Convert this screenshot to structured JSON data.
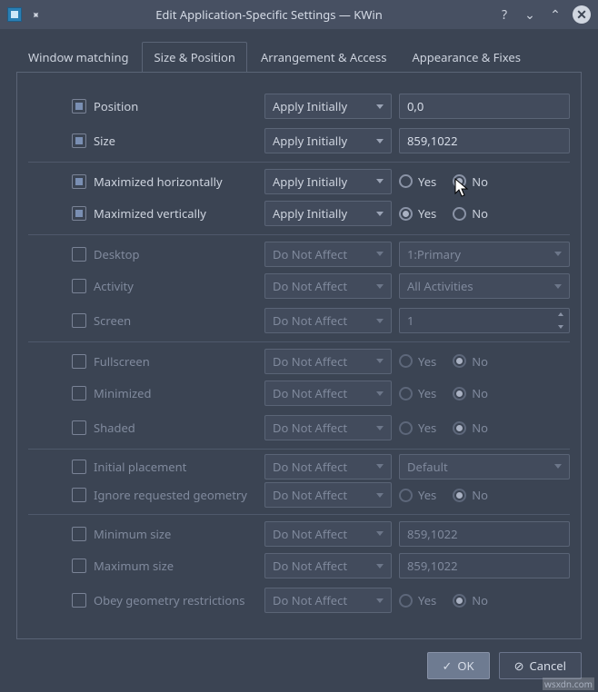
{
  "window": {
    "title": "Edit Application-Specific Settings — KWin"
  },
  "tabs": {
    "window_matching": "Window matching",
    "size_position": "Size & Position",
    "arrangement_access": "Arrangement & Access",
    "appearance_fixes": "Appearance & Fixes"
  },
  "apply": {
    "apply_initially": "Apply Initially",
    "do_not_affect": "Do Not Affect"
  },
  "labels": {
    "position": "Position",
    "size": "Size",
    "max_h": "Maximized horizontally",
    "max_v": "Maximized vertically",
    "desktop": "Desktop",
    "activity": "Activity",
    "screen": "Screen",
    "fullscreen": "Fullscreen",
    "minimized": "Minimized",
    "shaded": "Shaded",
    "initial_placement": "Initial placement",
    "ignore_geom": "Ignore requested geometry",
    "min_size": "Minimum size",
    "max_size": "Maximum size",
    "obey_geom": "Obey geometry restrictions"
  },
  "values": {
    "position": "0,0",
    "size": "859,1022",
    "min_size": "859,1022",
    "max_size": "859,1022",
    "desktop": "1:Primary",
    "activity": "All Activities",
    "screen": "1",
    "placement": "Default"
  },
  "radio": {
    "yes": "Yes",
    "no": "No"
  },
  "buttons": {
    "ok": "OK",
    "cancel": "Cancel"
  },
  "watermark": "wsxdn.com"
}
